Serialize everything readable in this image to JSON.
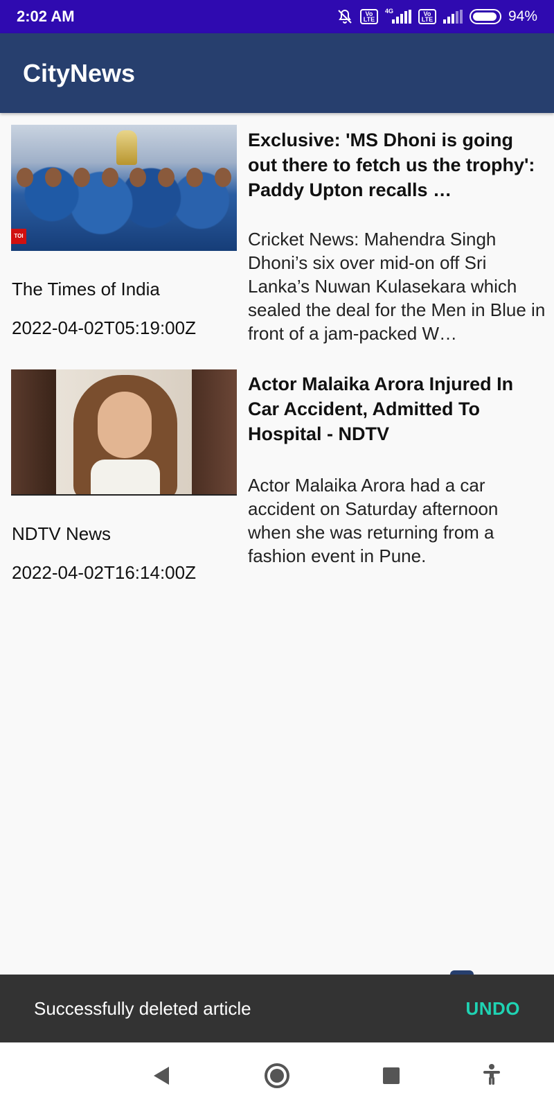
{
  "status_bar": {
    "time": "2:02 AM",
    "battery_pct": "94%",
    "battery_level": 0.94,
    "network_tag": "4G",
    "volte_label": "Vo LTE",
    "icons": [
      "bell-muted-icon",
      "volte-icon",
      "signal-icon",
      "volte-icon",
      "signal-icon",
      "battery-icon"
    ]
  },
  "app_bar": {
    "title": "CityNews"
  },
  "articles": [
    {
      "headline": "Exclusive: 'MS Dhoni is going out there to fetch us the trophy': Paddy Upton recalls …",
      "description": "Cricket News: Mahendra Singh Dhoni’s six over mid-on off Sri Lanka’s Nuwan Kulasekara which sealed the deal for the Men in Blue in front of a jam-packed W…",
      "source": "The Times of India",
      "published": "2022-04-02T05:19:00Z",
      "thumb_badge": "TOI"
    },
    {
      "headline": "Actor Malaika Arora Injured In Car Accident, Admitted To Hospital - NDTV",
      "description": "Actor Malaika Arora had a car accident on Saturday afternoon when she was returning from a fashion event in Pune.",
      "source": "NDTV News",
      "published": "2022-04-02T16:14:00Z"
    }
  ],
  "snackbar": {
    "message": "Successfully deleted article",
    "action": "UNDO",
    "action_color": "#1fd3b3"
  },
  "nav_bar": {
    "buttons": [
      "back-icon",
      "home-icon",
      "recents-icon",
      "accessibility-icon"
    ]
  },
  "colors": {
    "status_bar": "#2f0ab0",
    "app_bar": "#273f6e",
    "background": "#f9f9f9",
    "snackbar": "#333333"
  }
}
